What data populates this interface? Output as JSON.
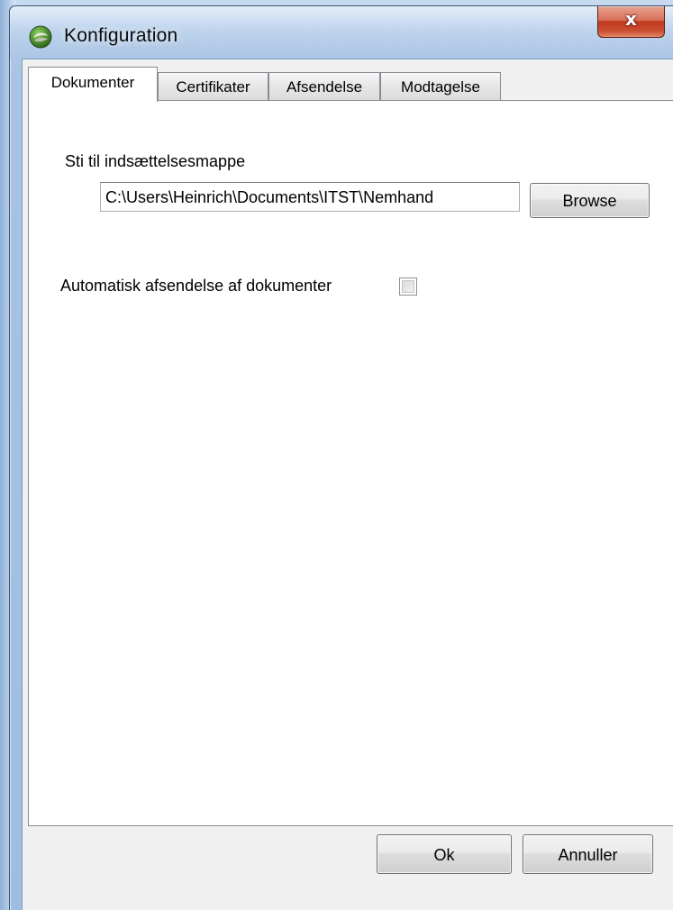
{
  "window": {
    "title": "Konfiguration",
    "close_glyph": "x"
  },
  "tabs": [
    {
      "label": "Dokumenter",
      "active": true
    },
    {
      "label": "Certifikater",
      "active": false
    },
    {
      "label": "Afsendelse",
      "active": false
    },
    {
      "label": "Modtagelse",
      "active": false
    }
  ],
  "dokumenter": {
    "path_label": "Sti til indsættelsesmappe",
    "path_value": "C:\\Users\\Heinrich\\Documents\\ITST\\Nemhand",
    "browse_label": "Browse",
    "auto_send_label": "Automatisk afsendelse af dokumenter",
    "auto_send_checked": false
  },
  "footer": {
    "ok_label": "Ok",
    "cancel_label": "Annuller"
  },
  "icons": {
    "app": "app-logo-icon",
    "close": "close-icon"
  }
}
